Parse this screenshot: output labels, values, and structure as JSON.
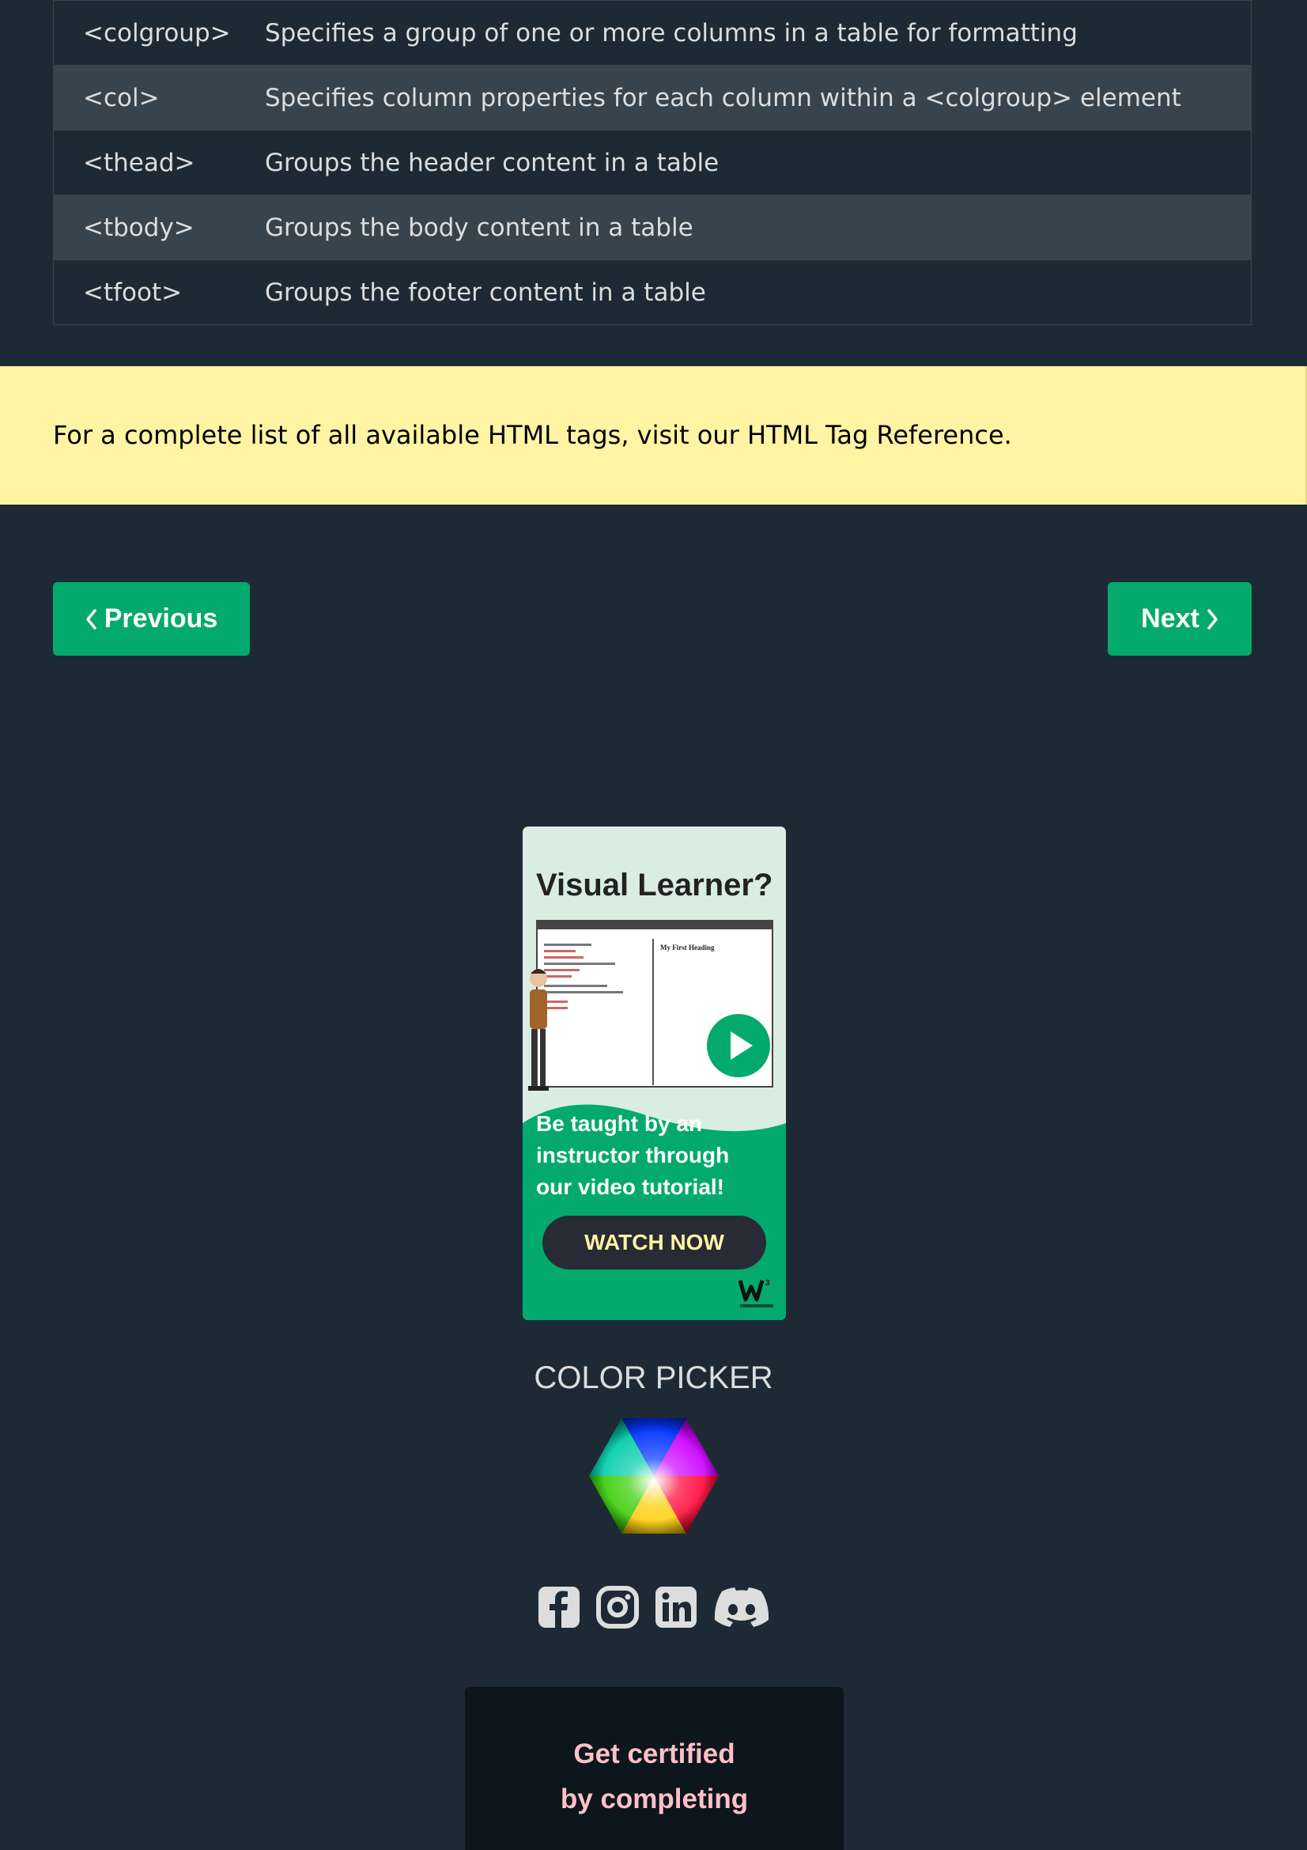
{
  "table": {
    "rows": [
      {
        "tag": "<colgroup>",
        "description": "Specifies a group of one or more columns in a table for formatting"
      },
      {
        "tag": "<col>",
        "description": "Specifies column properties for each column within a <colgroup> element"
      },
      {
        "tag": "<thead>",
        "description": "Groups the header content in a table"
      },
      {
        "tag": "<tbody>",
        "description": "Groups the body content in a table"
      },
      {
        "tag": "<tfoot>",
        "description": "Groups the footer content in a table"
      }
    ]
  },
  "note": {
    "text": "For a complete list of all available HTML tags, visit our HTML Tag Reference."
  },
  "nav": {
    "previous_label": "Previous",
    "next_label": "Next"
  },
  "ad": {
    "title": "Visual Learner?",
    "subtitle_line1": "Be taught by an",
    "subtitle_line2": "instructor through",
    "subtitle_line3": "our video tutorial!",
    "button_label": "WATCH NOW",
    "screen_heading": "My First Heading"
  },
  "color_picker": {
    "title": "COLOR PICKER"
  },
  "social": {
    "icons": [
      "facebook-icon",
      "instagram-icon",
      "linkedin-icon",
      "discord-icon"
    ]
  },
  "certified": {
    "line1": "Get certified",
    "line2": "by completing"
  },
  "colors": {
    "background": "#1d2a35",
    "row_alt": "#38444d",
    "note_bg": "#fff4a3",
    "accent": "#04aa6d",
    "cert_text": "#ffc0c7"
  }
}
